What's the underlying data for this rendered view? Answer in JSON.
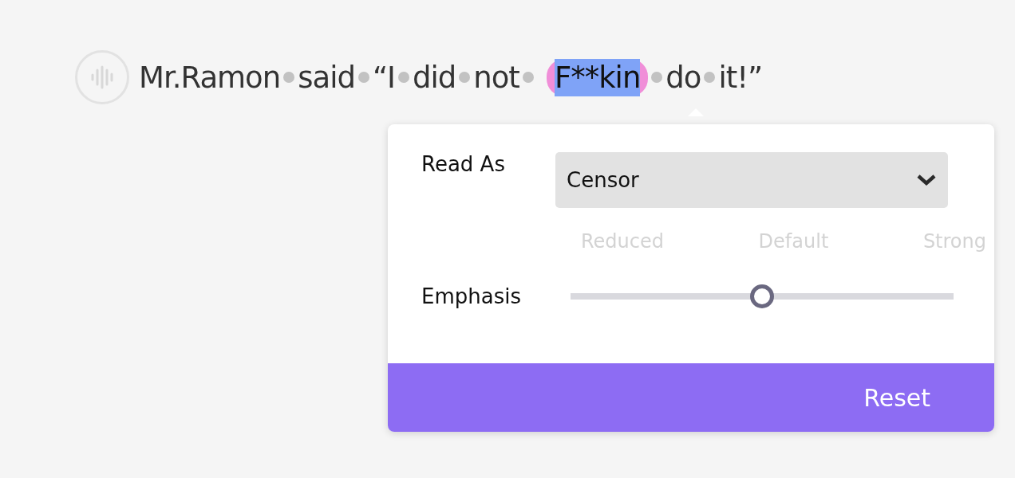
{
  "sentence": {
    "words": [
      {
        "text": "Mr.Ramon",
        "selected": false
      },
      {
        "text": "said",
        "selected": false
      },
      {
        "text": "“I",
        "selected": false
      },
      {
        "text": "did",
        "selected": false
      },
      {
        "text": "not",
        "selected": false
      },
      {
        "text": "F**kin",
        "selected": true
      },
      {
        "text": "do",
        "selected": false
      },
      {
        "text": "it!”",
        "selected": false
      }
    ]
  },
  "popover": {
    "read_as": {
      "label": "Read As",
      "value": "Censor"
    },
    "emphasis": {
      "label": "Emphasis",
      "stops": [
        "Reduced",
        "Default",
        "Strong"
      ],
      "level": 0.5
    },
    "reset_button": "Reset"
  }
}
